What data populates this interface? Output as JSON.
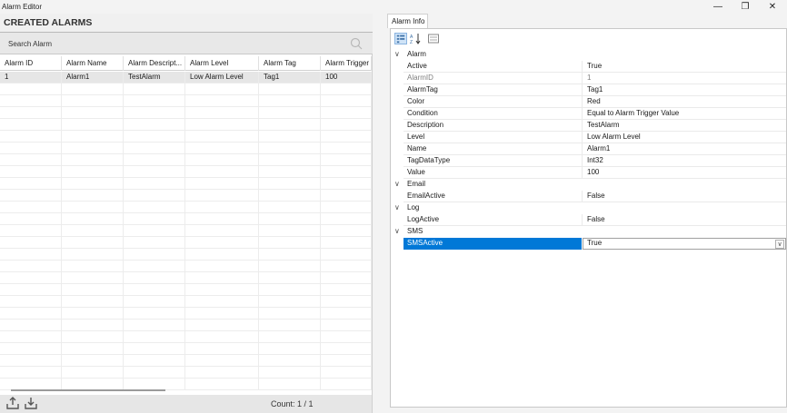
{
  "window": {
    "title": "Alarm Editor",
    "minimize": "—",
    "restore": "❐",
    "close": "✕"
  },
  "left": {
    "header": "CREATED ALARMS",
    "search_placeholder": "Search Alarm",
    "columns": [
      "Alarm ID",
      "Alarm Name",
      "Alarm Descript...",
      "Alarm Level",
      "Alarm Tag",
      "Alarm Trigger"
    ],
    "rows": [
      [
        "1",
        "Alarm1",
        "TestAlarm",
        "Low Alarm Level",
        "Tag1",
        "100"
      ]
    ],
    "count": "Count: 1 / 1"
  },
  "right": {
    "tab": "Alarm Info",
    "categories": [
      {
        "name": "Alarm",
        "props": [
          {
            "name": "Active",
            "value": "True"
          },
          {
            "name": "AlarmID",
            "value": "1",
            "readonly": true
          },
          {
            "name": "AlarmTag",
            "value": "Tag1"
          },
          {
            "name": "Color",
            "value": "Red"
          },
          {
            "name": "Condition",
            "value": "Equal to Alarm Trigger Value"
          },
          {
            "name": "Description",
            "value": "TestAlarm"
          },
          {
            "name": "Level",
            "value": "Low Alarm Level"
          },
          {
            "name": "Name",
            "value": "Alarm1"
          },
          {
            "name": "TagDataType",
            "value": "Int32"
          },
          {
            "name": "Value",
            "value": "100"
          }
        ]
      },
      {
        "name": "Email",
        "props": [
          {
            "name": "EmailActive",
            "value": "False"
          }
        ]
      },
      {
        "name": "Log",
        "props": [
          {
            "name": "LogActive",
            "value": "False"
          }
        ]
      },
      {
        "name": "SMS",
        "props": [
          {
            "name": "SMSActive",
            "value": "True",
            "selected": true
          }
        ]
      }
    ]
  },
  "colors": {
    "selection": "#0078d7",
    "accent": "#1e6fd9"
  }
}
